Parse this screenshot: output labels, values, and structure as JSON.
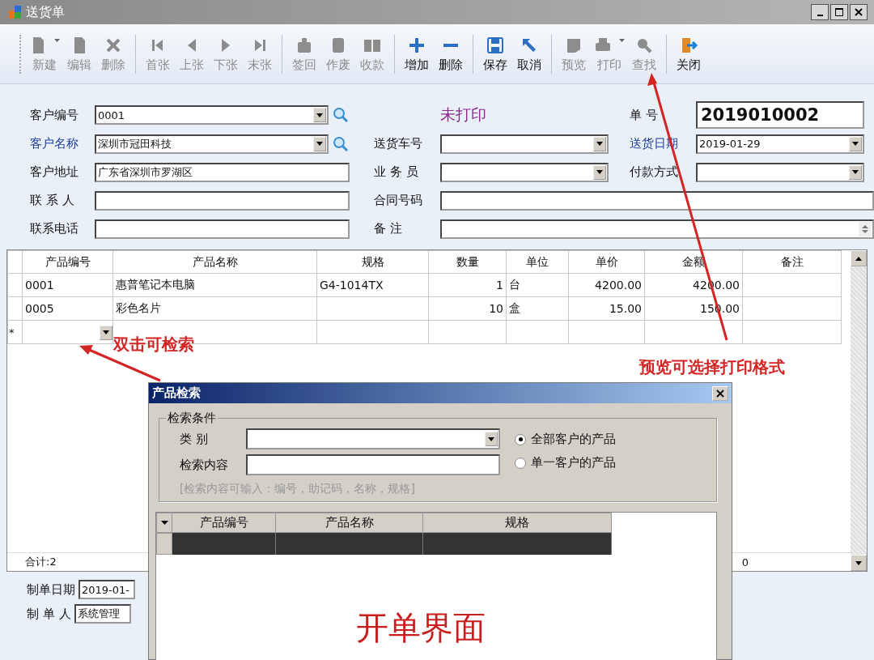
{
  "window": {
    "title": "送货单"
  },
  "toolbar": {
    "groups": [
      [
        {
          "kind": "new",
          "label": "新建",
          "enabled": false,
          "dropdown": true
        },
        {
          "kind": "edit",
          "label": "编辑",
          "enabled": false
        },
        {
          "kind": "delete",
          "label": "删除",
          "enabled": false
        }
      ],
      [
        {
          "kind": "first",
          "label": "首张",
          "enabled": false
        },
        {
          "kind": "prev",
          "label": "上张",
          "enabled": false
        },
        {
          "kind": "next",
          "label": "下张",
          "enabled": false
        },
        {
          "kind": "last",
          "label": "末张",
          "enabled": false
        }
      ],
      [
        {
          "kind": "signback",
          "label": "签回",
          "enabled": false
        },
        {
          "kind": "void",
          "label": "作废",
          "enabled": false
        },
        {
          "kind": "receipt",
          "label": "收款",
          "enabled": false
        }
      ],
      [
        {
          "kind": "add",
          "label": "增加",
          "enabled": true
        },
        {
          "kind": "remove",
          "label": "删除",
          "enabled": true
        }
      ],
      [
        {
          "kind": "save",
          "label": "保存",
          "enabled": true
        },
        {
          "kind": "cancel",
          "label": "取消",
          "enabled": true
        }
      ],
      [
        {
          "kind": "preview",
          "label": "预览",
          "enabled": false
        },
        {
          "kind": "print",
          "label": "打印",
          "enabled": false,
          "dropdown": true
        },
        {
          "kind": "find",
          "label": "查找",
          "enabled": false
        }
      ],
      [
        {
          "kind": "close",
          "label": "关闭",
          "enabled": true
        }
      ]
    ]
  },
  "form": {
    "rows": [
      [
        {
          "kind": "combo",
          "label": "客户编号",
          "value": "0001",
          "search": true,
          "required": false
        },
        {
          "kind": "status",
          "value": "未打印"
        },
        {
          "kind": "number",
          "label": "单 号",
          "value": "2019010002",
          "required": false
        }
      ],
      [
        {
          "kind": "combo",
          "label": "客户名称",
          "value": "深圳市冠田科技",
          "search": true,
          "required": true
        },
        {
          "kind": "combo",
          "label": "送货车号",
          "search": false,
          "required": false
        },
        {
          "kind": "combo",
          "label": "送货日期",
          "value": "2019-01-29",
          "search": false,
          "required": true
        }
      ],
      [
        {
          "kind": "input",
          "label": "客户地址",
          "value": "广东省深圳市罗湖区",
          "required": false
        },
        {
          "kind": "combo",
          "label": "业 务 员",
          "search": false,
          "required": false
        },
        {
          "kind": "combo",
          "label": "付款方式",
          "search": false,
          "required": false
        }
      ],
      [
        {
          "kind": "input",
          "label": "联 系 人",
          "required": false
        },
        {
          "kind": "input",
          "label": "合同号码",
          "required": false
        }
      ],
      [
        {
          "kind": "input",
          "label": "联系电话",
          "required": false
        },
        {
          "kind": "memo",
          "label": "备 注",
          "required": false
        }
      ]
    ]
  },
  "table": {
    "columns": [
      {
        "label": "产品编号",
        "numeric": false
      },
      {
        "label": "产品名称",
        "numeric": false
      },
      {
        "label": "规格",
        "numeric": false
      },
      {
        "label": "数量",
        "numeric": true
      },
      {
        "label": "单位",
        "numeric": false
      },
      {
        "label": "单价",
        "numeric": true
      },
      {
        "label": "金额",
        "numeric": true
      },
      {
        "label": "备注"
      }
    ],
    "rows": [
      {
        "cells": [
          "0001",
          "惠普笔记本电脑",
          "G4-1014TX",
          "1",
          "台",
          "4200.00",
          "4200.00"
        ]
      },
      {
        "cells": [
          "0005",
          "彩色名片",
          null,
          "10",
          "盒",
          "15.00",
          "150.00"
        ]
      }
    ],
    "new_row": {
      "marker": "*"
    },
    "footer": {
      "count": "合计:2",
      "amount": "0"
    }
  },
  "bottom": {
    "fields": [
      {
        "label": "制单日期",
        "value": "2019-01-"
      },
      {
        "label": "制 单 人",
        "value": "系统管理"
      }
    ]
  },
  "dialog": {
    "title": "产品检索",
    "group": {
      "title": "检索条件",
      "fields": [
        {
          "kind": "combo",
          "label": "类 别"
        },
        {
          "kind": "input",
          "label": "检索内容"
        }
      ],
      "options": [
        {
          "label": "全部客户的产品",
          "selected": true
        },
        {
          "label": "单一客户的产品",
          "selected": false
        }
      ],
      "hint": "[检索内容可输入：编号，助记码，名称，规格]"
    },
    "table": {
      "columns": [
        "产品编号",
        "产品名称",
        "规格"
      ]
    }
  },
  "annotations": [
    {
      "text": "双击可检索"
    },
    {
      "text": "预览可选择打印格式"
    },
    {
      "text": "开单界面"
    }
  ]
}
